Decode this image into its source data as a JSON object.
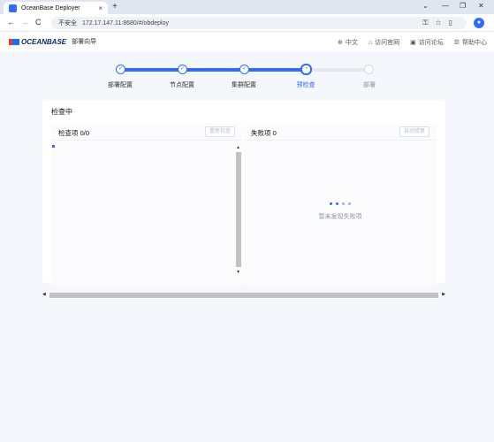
{
  "browser": {
    "tab_title": "OceanBase Deployer",
    "tab_close": "×",
    "new_tab": "+",
    "window_controls": [
      "⌄",
      "—",
      "❐",
      "✕"
    ],
    "nav": {
      "back": "←",
      "forward": "→",
      "reload": "C"
    },
    "security_label": "不安全",
    "url": "172.17.147.11:8680/#/obdeploy",
    "profile_initial": "●"
  },
  "app": {
    "brand": "OCEANBASE",
    "subtitle": "部署向导",
    "header_links": [
      {
        "icon": "globe-icon",
        "glyph": "⊕",
        "label": "中文"
      },
      {
        "icon": "home-icon",
        "glyph": "⌂",
        "label": "访问官网"
      },
      {
        "icon": "forum-icon",
        "glyph": "▣",
        "label": "访问论坛"
      },
      {
        "icon": "help-icon",
        "glyph": "☰",
        "label": "帮助中心"
      }
    ]
  },
  "steps": [
    {
      "label": "部署配置",
      "state": "done"
    },
    {
      "label": "节点配置",
      "state": "done"
    },
    {
      "label": "集群配置",
      "state": "done"
    },
    {
      "label": "预检查",
      "state": "current"
    },
    {
      "label": "部署",
      "state": "todo"
    }
  ],
  "card": {
    "title": "检查中",
    "left_panel": {
      "title": "检查项 0/0",
      "button": "重新检查"
    },
    "right_panel": {
      "title": "失败项 0",
      "button": "自动修复",
      "empty_text": "暂未发现失败项"
    }
  },
  "colors": {
    "accent": "#2f6bff",
    "page_bg": "#f4f7fc"
  }
}
